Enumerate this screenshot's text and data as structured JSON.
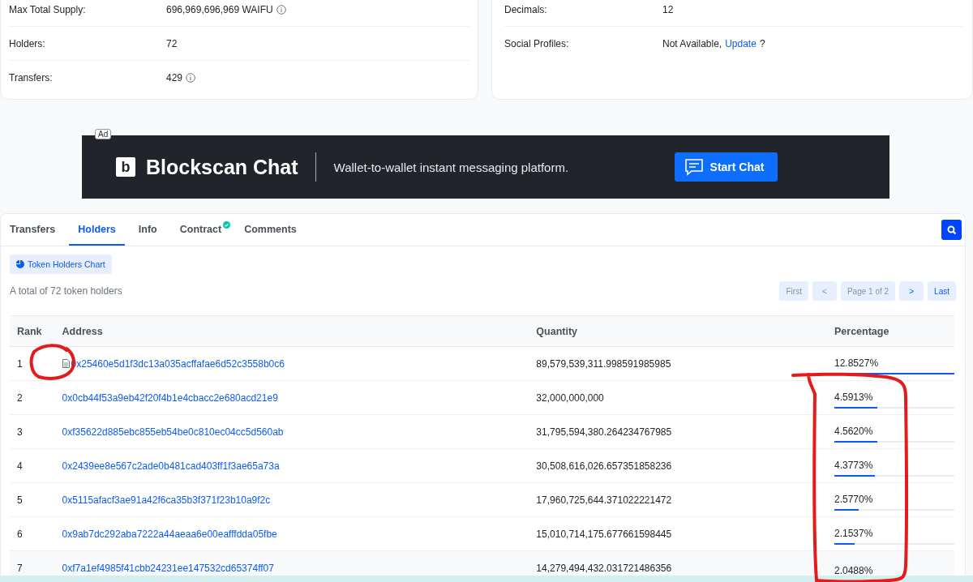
{
  "overview": {
    "left": [
      {
        "label": "Max Total Supply:",
        "value": "696,969,696,969 WAIFU",
        "info": true
      },
      {
        "label": "Holders:",
        "value": "72",
        "info": false
      },
      {
        "label": "Transfers:",
        "value": "429",
        "info": true
      }
    ],
    "right": [
      {
        "label": "Decimals:",
        "value": "12"
      },
      {
        "label": "Social Profiles:",
        "value": "Not Available,",
        "link": "Update",
        "suffix": "?"
      }
    ]
  },
  "ad": {
    "badge": "Ad",
    "brand_letter": "b",
    "brand": "Blockscan Chat",
    "tagline": "Wallet-to-wallet instant messaging platform.",
    "button": "Start Chat"
  },
  "tabs": [
    {
      "label": "Transfers",
      "selected": false,
      "verified": false
    },
    {
      "label": "Holders",
      "selected": true,
      "verified": false
    },
    {
      "label": "Info",
      "selected": false,
      "verified": false
    },
    {
      "label": "Contract",
      "selected": false,
      "verified": true
    },
    {
      "label": "Comments",
      "selected": false,
      "verified": false
    }
  ],
  "chart_button": "Token Holders Chart",
  "summary": "A total of 72 token holders",
  "pagination": [
    {
      "label": "First",
      "disabled": true
    },
    {
      "label": "<",
      "disabled": true
    },
    {
      "label": "Page 1 of 2",
      "disabled": true
    },
    {
      "label": ">",
      "disabled": false
    },
    {
      "label": "Last",
      "disabled": false
    }
  ],
  "table": {
    "columns": [
      "Rank",
      "Address",
      "Quantity",
      "Percentage"
    ],
    "rows": [
      {
        "rank": "1",
        "contract": true,
        "address": "0x25460e5d1f3dc13a035acffafae6d52c3558b0c6",
        "quantity": "89,579,539,311.998591985985",
        "percentage": "12.8527%",
        "level": 1
      },
      {
        "rank": "2",
        "contract": false,
        "address": "0x0cb44f53a9eb42f20f4b1e4cbacc2e680acd21e9",
        "quantity": "32,000,000,000",
        "percentage": "4.5913%",
        "level": 0.357
      },
      {
        "rank": "3",
        "contract": false,
        "address": "0xf35622d885ebc855eb54be0c810ec04cc5d560ab",
        "quantity": "31,795,594,380.264234767985",
        "percentage": "4.5620%",
        "level": 0.355
      },
      {
        "rank": "4",
        "contract": false,
        "address": "0x2439ee8e567c2ade0b481cad403ff1f3ae65a73a",
        "quantity": "30,508,616,026.657351858236",
        "percentage": "4.3773%",
        "level": 0.341
      },
      {
        "rank": "5",
        "contract": false,
        "address": "0x5115afacf3ae91a42f6ca35b3f371f23b10a9f2c",
        "quantity": "17,960,725,644.371022221472",
        "percentage": "2.5770%",
        "level": 0.2
      },
      {
        "rank": "6",
        "contract": false,
        "address": "0x9ab7dc292aba7222a44aeaa6e00eafffdda05fbe",
        "quantity": "15,010,714,175.677661598445",
        "percentage": "2.1537%",
        "level": 0.168
      },
      {
        "rank": "7",
        "contract": false,
        "address": "0xf7a1ef4985f41cbb24231ee147532cd65374ff07",
        "quantity": "14,279,494,432.031721486356",
        "percentage": "2.0488%"
      }
    ]
  }
}
